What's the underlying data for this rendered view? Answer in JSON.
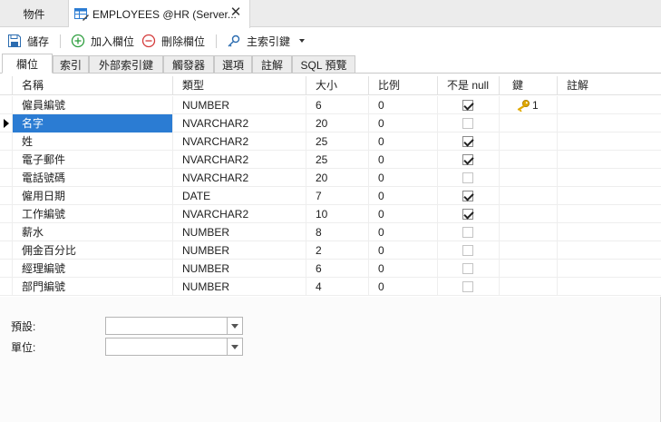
{
  "top_tabs": {
    "objects_label": "物件",
    "editor_label": "EMPLOYEES @HR (Server..."
  },
  "toolbar": {
    "save_label": "儲存",
    "add_field_label": "加入欄位",
    "delete_field_label": "刪除欄位",
    "primary_key_label": "主索引鍵"
  },
  "sub_tabs": [
    {
      "label": "欄位"
    },
    {
      "label": "索引"
    },
    {
      "label": "外部索引鍵"
    },
    {
      "label": "觸發器"
    },
    {
      "label": "選項"
    },
    {
      "label": "註解"
    },
    {
      "label": "SQL 預覽"
    }
  ],
  "grid": {
    "headers": {
      "name": "名稱",
      "type": "類型",
      "size": "大小",
      "scale": "比例",
      "not_null": "不是 null",
      "key": "鍵",
      "comment": "註解"
    },
    "rows": [
      {
        "name": "僱員編號",
        "type": "NUMBER",
        "size": "6",
        "scale": "0",
        "not_null": true,
        "key": "1"
      },
      {
        "name": "名字",
        "type": "NVARCHAR2",
        "size": "20",
        "scale": "0",
        "not_null": false,
        "key": ""
      },
      {
        "name": "姓",
        "type": "NVARCHAR2",
        "size": "25",
        "scale": "0",
        "not_null": true,
        "key": ""
      },
      {
        "name": "電子郵件",
        "type": "NVARCHAR2",
        "size": "25",
        "scale": "0",
        "not_null": true,
        "key": ""
      },
      {
        "name": "電話號碼",
        "type": "NVARCHAR2",
        "size": "20",
        "scale": "0",
        "not_null": false,
        "key": ""
      },
      {
        "name": "僱用日期",
        "type": "DATE",
        "size": "7",
        "scale": "0",
        "not_null": true,
        "key": ""
      },
      {
        "name": "工作編號",
        "type": "NVARCHAR2",
        "size": "10",
        "scale": "0",
        "not_null": true,
        "key": ""
      },
      {
        "name": "薪水",
        "type": "NUMBER",
        "size": "8",
        "scale": "0",
        "not_null": false,
        "key": ""
      },
      {
        "name": "佣金百分比",
        "type": "NUMBER",
        "size": "2",
        "scale": "0",
        "not_null": false,
        "key": ""
      },
      {
        "name": "經理編號",
        "type": "NUMBER",
        "size": "6",
        "scale": "0",
        "not_null": false,
        "key": ""
      },
      {
        "name": "部門編號",
        "type": "NUMBER",
        "size": "4",
        "scale": "0",
        "not_null": false,
        "key": ""
      }
    ]
  },
  "form": {
    "default_label": "預設:",
    "default_value": "",
    "unit_label": "單位:",
    "unit_value": ""
  },
  "colors": {
    "selection": "#2b7cd3",
    "add_icon": "#2e9e3f",
    "delete_icon": "#d43a3a",
    "key_icon": "#e0a800"
  }
}
